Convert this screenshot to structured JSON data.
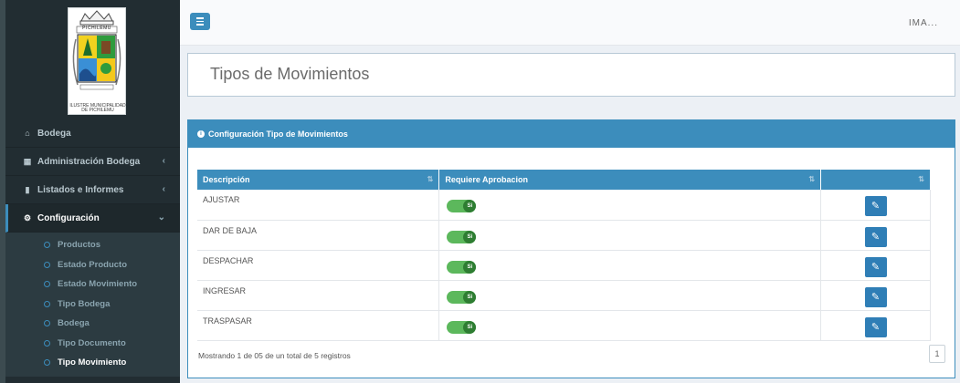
{
  "logo": {
    "town": "PICHILEMU",
    "caption_line1": "ILUSTRE MUNICIPALIDAD",
    "caption_line2": "DE PICHILEMU"
  },
  "sidebar": {
    "items": [
      {
        "label": "Bodega",
        "icon": "home-icon"
      },
      {
        "label": "Administración Bodega",
        "icon": "table-icon"
      },
      {
        "label": "Listados e Informes",
        "icon": "file-icon"
      },
      {
        "label": "Configuración",
        "icon": "gears-icon"
      }
    ],
    "submenu": [
      {
        "label": "Productos"
      },
      {
        "label": "Estado Producto"
      },
      {
        "label": "Estado Movimiento"
      },
      {
        "label": "Tipo Bodega"
      },
      {
        "label": "Bodega"
      },
      {
        "label": "Tipo Documento"
      },
      {
        "label": "Tipo Movimiento"
      }
    ]
  },
  "topbar": {
    "user": "IMA..."
  },
  "page": {
    "title": "Tipos de Movimientos"
  },
  "panel": {
    "title": "Configuración Tipo de Movimientos"
  },
  "table": {
    "headers": [
      "Descripción",
      "Requiere Aprobacion",
      ""
    ],
    "rows": [
      {
        "descripcion": "AJUSTAR",
        "toggle": "Si"
      },
      {
        "descripcion": "DAR DE BAJA",
        "toggle": "Si"
      },
      {
        "descripcion": "DESPACHAR",
        "toggle": "Si"
      },
      {
        "descripcion": "INGRESAR",
        "toggle": "Si"
      },
      {
        "descripcion": "TRASPASAR",
        "toggle": "Si"
      }
    ]
  },
  "footer": {
    "info": "Mostrando 1 de 05 de un total de 5 registros",
    "page": "1"
  },
  "colors": {
    "accent": "#3c8dbc",
    "sidebar": "#222d32",
    "toggle_on": "#5cb85c",
    "edit_button": "#2f7eb6"
  }
}
